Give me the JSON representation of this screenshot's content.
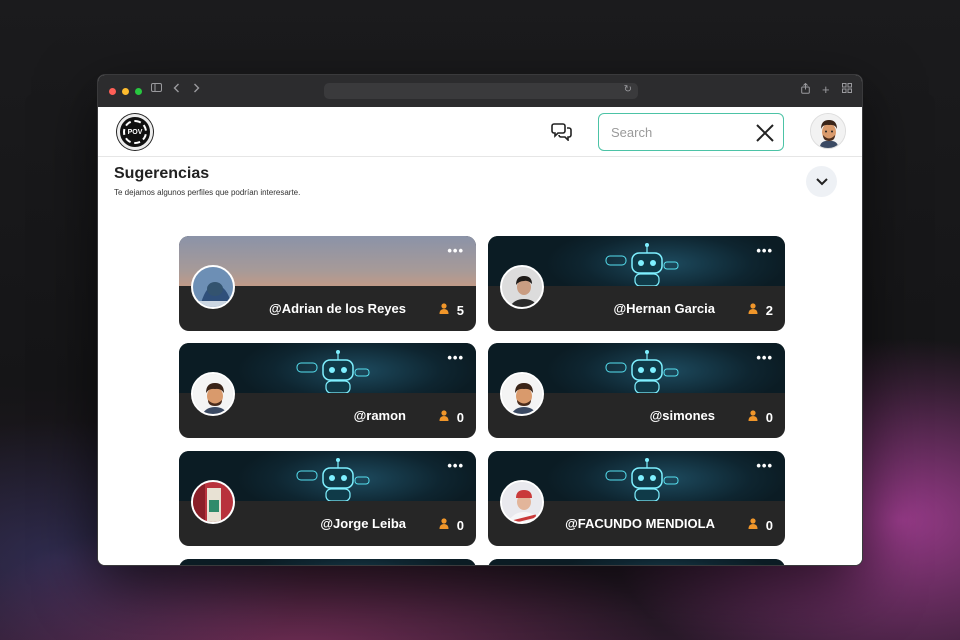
{
  "header": {
    "search_placeholder": "Search",
    "logo_text": "POV"
  },
  "suggestions": {
    "title": "Sugerencias",
    "subtitle": "Te dejamos algunos perfiles que podrían interesarte."
  },
  "cards": [
    {
      "handle": "@Adrian de los Reyes",
      "followers": "5",
      "banner": "gradient"
    },
    {
      "handle": "@Hernan Garcia",
      "followers": "2",
      "banner": "robot"
    },
    {
      "handle": "@ramon",
      "followers": "0",
      "banner": "robot"
    },
    {
      "handle": "@simones",
      "followers": "0",
      "banner": "robot"
    },
    {
      "handle": "@Jorge Leiba",
      "followers": "0",
      "banner": "robot"
    },
    {
      "handle": "@FACUNDO MENDIOLA",
      "followers": "0",
      "banner": "robot"
    }
  ],
  "colors": {
    "accent": "#4cc3a6",
    "follower_icon": "#f0962a",
    "card_bg": "#262626"
  },
  "icons": {
    "chat": "chat-bubbles-icon",
    "close": "close-icon",
    "collapse": "chevron-down-icon",
    "more": "more-horizontal-icon",
    "followers": "user-icon"
  }
}
